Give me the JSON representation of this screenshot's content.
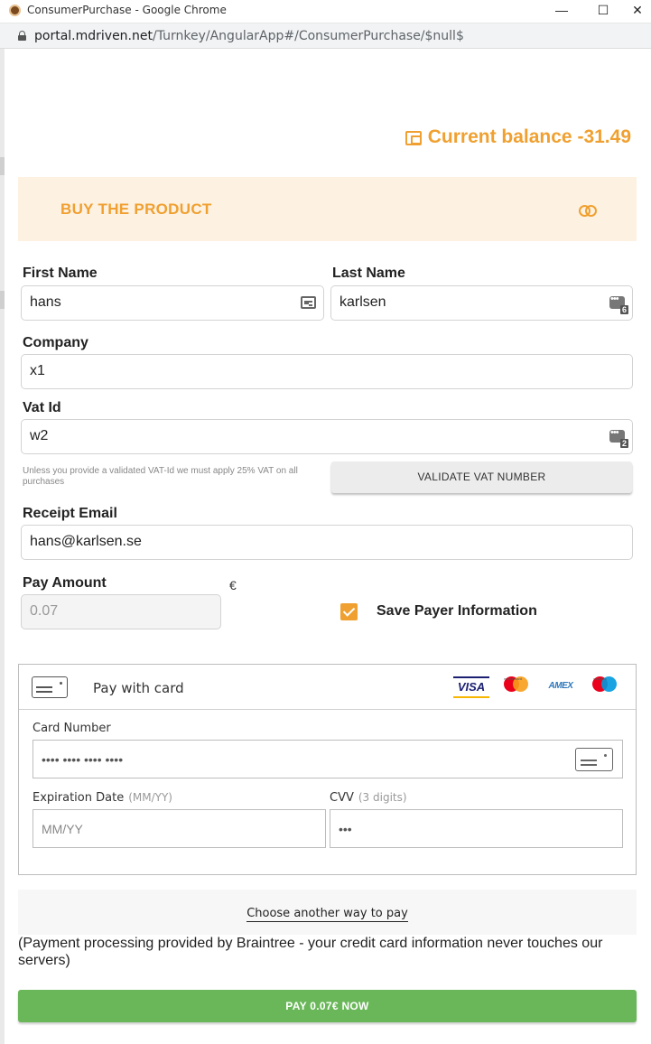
{
  "window": {
    "title": "ConsumerPurchase - Google Chrome",
    "minimize": "—",
    "maximize": "☐",
    "close": "✕",
    "url_host": "portal.mdriven.net",
    "url_path": "/Turnkey/AngularApp#/ConsumerPurchase/$null$"
  },
  "balance": {
    "text": "Current balance -31.49"
  },
  "banner": {
    "title": "BUY THE PRODUCT"
  },
  "form": {
    "first_name": {
      "label": "First Name",
      "value": "hans"
    },
    "last_name": {
      "label": "Last Name",
      "value": "karlsen",
      "badge": "6"
    },
    "company": {
      "label": "Company",
      "value": "x1"
    },
    "vat_id": {
      "label": "Vat Id",
      "value": "w2",
      "badge": "2"
    },
    "vat_hint": "Unless you provide a validated VAT-Id we must apply 25% VAT on all purchases",
    "validate_button": "VALIDATE VAT NUMBER",
    "receipt_email": {
      "label": "Receipt Email",
      "value": "hans@karlsen.se"
    },
    "pay_amount": {
      "label": "Pay Amount",
      "value": "0.07",
      "currency": "€"
    },
    "save_payer": {
      "label": "Save Payer Information",
      "checked": true
    }
  },
  "card": {
    "title": "Pay with card",
    "brands": {
      "visa": "VISA",
      "mastercard_mini": "mastercard",
      "amex": "AMEX",
      "maestro_mini": "maestro"
    },
    "number": {
      "label": "Card Number",
      "placeholder": "•••• •••• •••• ••••"
    },
    "expiration": {
      "label": "Expiration Date",
      "hint": "(MM/YY)",
      "placeholder": "MM/YY"
    },
    "cvv": {
      "label": "CVV",
      "hint": "(3 digits)",
      "placeholder": "•••"
    }
  },
  "another_way": "Choose another way to pay",
  "braintree_note": "(Payment processing provided by Braintree - your credit card information never touches our servers)",
  "pay_button": "PAY 0.07€ NOW",
  "colors": {
    "accent": "#f0a030",
    "banner_bg": "#fdf1e2",
    "pay_green": "#6ab759"
  }
}
